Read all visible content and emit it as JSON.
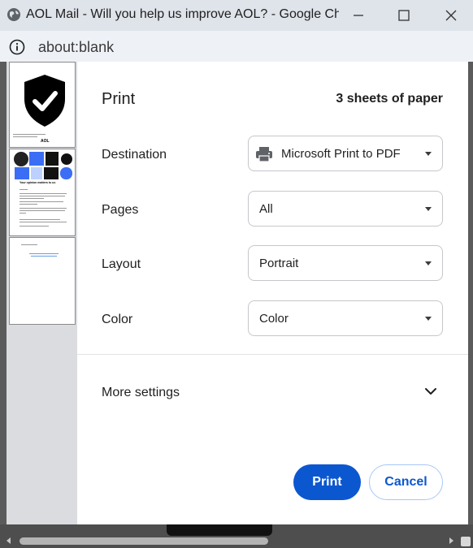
{
  "window": {
    "title": "AOL Mail - Will you help us improve AOL? - Google Chr...",
    "url": "about:blank"
  },
  "print": {
    "title": "Print",
    "sheets": "3 sheets of paper",
    "destination": {
      "label": "Destination",
      "value": "Microsoft Print to PDF"
    },
    "pages": {
      "label": "Pages",
      "value": "All"
    },
    "layout": {
      "label": "Layout",
      "value": "Portrait"
    },
    "color": {
      "label": "Color",
      "value": "Color"
    },
    "more_settings": "More settings",
    "print_button": "Print",
    "cancel_button": "Cancel"
  },
  "preview": {
    "page1_logo": "AOL",
    "page2_heading": "Your opinion matters to us"
  },
  "colors": {
    "accent": "#0b57d0",
    "titlebar": "#dfe3ea",
    "preview_bg": "#dadce0"
  }
}
